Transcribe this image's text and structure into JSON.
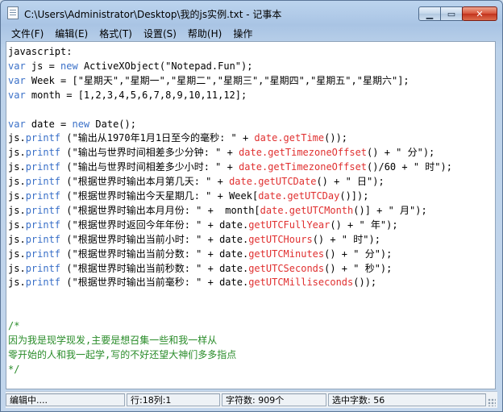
{
  "window": {
    "title": "C:\\Users\\Administrator\\Desktop\\我的js实例.txt - 记事本",
    "min_symbol": "▁",
    "max_symbol": "▭",
    "close_symbol": "✕"
  },
  "menu": [
    "文件(F)",
    "编辑(E)",
    "格式(T)",
    "设置(S)",
    "帮助(H)",
    "操作"
  ],
  "colors": {
    "keyword": "#3a70c8",
    "method": "#e03030",
    "comment": "#2a8c2a",
    "text": "#000000"
  },
  "code_lines": [
    [
      {
        "t": "javascript:",
        "c": "text"
      }
    ],
    [
      {
        "t": "var",
        "c": "keyword"
      },
      {
        "t": " js = ",
        "c": "text"
      },
      {
        "t": "new",
        "c": "keyword"
      },
      {
        "t": " ActiveXObject(\"Notepad.Fun\");",
        "c": "text"
      }
    ],
    [
      {
        "t": "var",
        "c": "keyword"
      },
      {
        "t": " Week = [\"星期天\",\"星期一\",\"星期二\",\"星期三\",\"星期四\",\"星期五\",\"星期六\"];",
        "c": "text"
      }
    ],
    [
      {
        "t": "var",
        "c": "keyword"
      },
      {
        "t": " month = [1,2,3,4,5,6,7,8,9,10,11,12];",
        "c": "text"
      }
    ],
    [],
    [
      {
        "t": "var",
        "c": "keyword"
      },
      {
        "t": " date = ",
        "c": "text"
      },
      {
        "t": "new",
        "c": "keyword"
      },
      {
        "t": " Date();",
        "c": "text"
      }
    ],
    [
      {
        "t": "js.",
        "c": "text"
      },
      {
        "t": "printf",
        "c": "keyword"
      },
      {
        "t": " (\"输出从1970年1月1日至今的毫秒: \" + ",
        "c": "text"
      },
      {
        "t": "date.getTime",
        "c": "method"
      },
      {
        "t": "());",
        "c": "text"
      }
    ],
    [
      {
        "t": "js.",
        "c": "text"
      },
      {
        "t": "printf",
        "c": "keyword"
      },
      {
        "t": " (\"输出与世界时间相差多少分钟: \" + ",
        "c": "text"
      },
      {
        "t": "date.getTimezoneOffset",
        "c": "method"
      },
      {
        "t": "() + \" 分\");",
        "c": "text"
      }
    ],
    [
      {
        "t": "js.",
        "c": "text"
      },
      {
        "t": "printf",
        "c": "keyword"
      },
      {
        "t": " (\"输出与世界时间相差多少小时: \" + ",
        "c": "text"
      },
      {
        "t": "date.getTimezoneOffset",
        "c": "method"
      },
      {
        "t": "()/60 + \" 时\");",
        "c": "text"
      }
    ],
    [
      {
        "t": "js.",
        "c": "text"
      },
      {
        "t": "printf",
        "c": "keyword"
      },
      {
        "t": " (\"根据世界时输出本月第几天: \" + ",
        "c": "text"
      },
      {
        "t": "date.getUTCDate",
        "c": "method"
      },
      {
        "t": "() + \" 日\");",
        "c": "text"
      }
    ],
    [
      {
        "t": "js.",
        "c": "text"
      },
      {
        "t": "printf",
        "c": "keyword"
      },
      {
        "t": " (\"根据世界时输出今天星期几: \" + Week[",
        "c": "text"
      },
      {
        "t": "date.getUTCDay",
        "c": "method"
      },
      {
        "t": "()]);",
        "c": "text"
      }
    ],
    [
      {
        "t": "js.",
        "c": "text"
      },
      {
        "t": "printf",
        "c": "keyword"
      },
      {
        "t": " (\"根据世界时输出本月月份: \" +  month[",
        "c": "text"
      },
      {
        "t": "date.getUTCMonth",
        "c": "method"
      },
      {
        "t": "()] + \" 月\");",
        "c": "text"
      }
    ],
    [
      {
        "t": "js.",
        "c": "text"
      },
      {
        "t": "printf",
        "c": "keyword"
      },
      {
        "t": " (\"根据世界时返回今年年份: \" + date.",
        "c": "text"
      },
      {
        "t": "getUTCFullYear",
        "c": "method"
      },
      {
        "t": "() + \" 年\");",
        "c": "text"
      }
    ],
    [
      {
        "t": "js.",
        "c": "text"
      },
      {
        "t": "printf",
        "c": "keyword"
      },
      {
        "t": " (\"根据世界时输出当前小时: \" + date.",
        "c": "text"
      },
      {
        "t": "getUTCHours",
        "c": "method"
      },
      {
        "t": "() + \" 时\");",
        "c": "text"
      }
    ],
    [
      {
        "t": "js.",
        "c": "text"
      },
      {
        "t": "printf",
        "c": "keyword"
      },
      {
        "t": " (\"根据世界时输出当前分数: \" + date.",
        "c": "text"
      },
      {
        "t": "getUTCMinutes",
        "c": "method"
      },
      {
        "t": "() + \" 分\");",
        "c": "text"
      }
    ],
    [
      {
        "t": "js.",
        "c": "text"
      },
      {
        "t": "printf",
        "c": "keyword"
      },
      {
        "t": " (\"根据世界时输出当前秒数: \" + date.",
        "c": "text"
      },
      {
        "t": "getUTCSeconds",
        "c": "method"
      },
      {
        "t": "() + \" 秒\");",
        "c": "text"
      }
    ],
    [
      {
        "t": "js.",
        "c": "text"
      },
      {
        "t": "printf",
        "c": "keyword"
      },
      {
        "t": " (\"根据世界时输出当前毫秒: \" + date.",
        "c": "text"
      },
      {
        "t": "getUTCMilliseconds",
        "c": "method"
      },
      {
        "t": "());",
        "c": "text"
      }
    ],
    [],
    [],
    [
      {
        "t": "/*",
        "c": "comment"
      }
    ],
    [
      {
        "t": "因为我是现学现发,主要是想召集一些和我一样从",
        "c": "comment"
      }
    ],
    [
      {
        "t": "零开始的人和我一起学,写的不好还望大神们多多指点",
        "c": "comment"
      }
    ],
    [
      {
        "t": "*/",
        "c": "comment"
      }
    ]
  ],
  "status": {
    "mode": "编辑中....",
    "position": "行:18列:1",
    "char_count": "字符数: 909个",
    "selected_count": "选中字数: 56"
  }
}
